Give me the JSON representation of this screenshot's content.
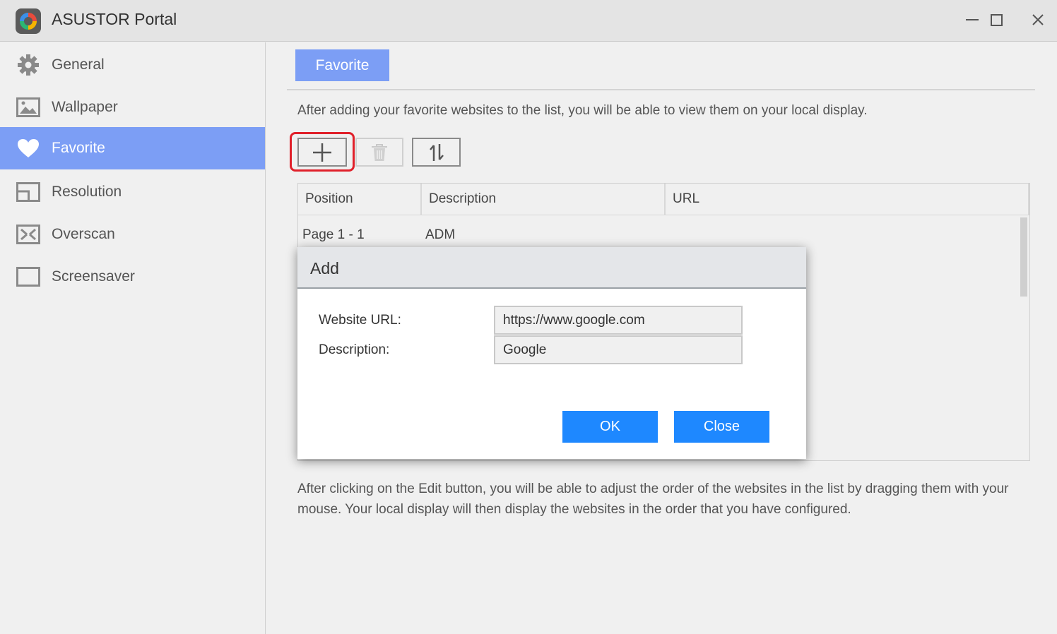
{
  "window": {
    "title": "ASUSTOR Portal",
    "logo_icon": "asustor-portal-logo",
    "controls": [
      "minimize",
      "maximize",
      "close"
    ]
  },
  "sidebar": {
    "items": [
      {
        "label": "General",
        "icon": "gear-icon",
        "active": false
      },
      {
        "label": "Wallpaper",
        "icon": "picture-icon",
        "active": false
      },
      {
        "label": "Favorite",
        "icon": "heart-icon",
        "active": true
      },
      {
        "label": "Resolution",
        "icon": "display-icon",
        "active": false
      },
      {
        "label": "Overscan",
        "icon": "overscan-icon",
        "active": false
      },
      {
        "label": "Screensaver",
        "icon": "screensaver-icon",
        "active": false
      }
    ]
  },
  "main": {
    "tab_label": "Favorite",
    "intro_text": "After adding your favorite websites to the list, you will be able to view them on your local display.",
    "toolbar": {
      "add_icon": "plus-icon",
      "delete_icon": "trash-icon",
      "sort_icon": "sort-icon"
    },
    "table": {
      "columns": [
        "Position",
        "Description",
        "URL"
      ],
      "rows": [
        {
          "position": "Page 1 - 1",
          "description": "ADM",
          "url": ""
        }
      ]
    },
    "footer_text": "After clicking on the Edit button, you will be able to adjust the order of the websites in the list by dragging them with your mouse. Your local display will then display the websites in the order that you have configured."
  },
  "dialog": {
    "title": "Add",
    "url_label": "Website URL:",
    "url_value": "https://www.google.com",
    "description_label": "Description:",
    "description_value": "Google",
    "ok_label": "OK",
    "close_label": "Close"
  },
  "colors": {
    "accent": "#7c9ef5",
    "button_blue": "#1e88ff",
    "highlight_red": "#e0202a"
  }
}
